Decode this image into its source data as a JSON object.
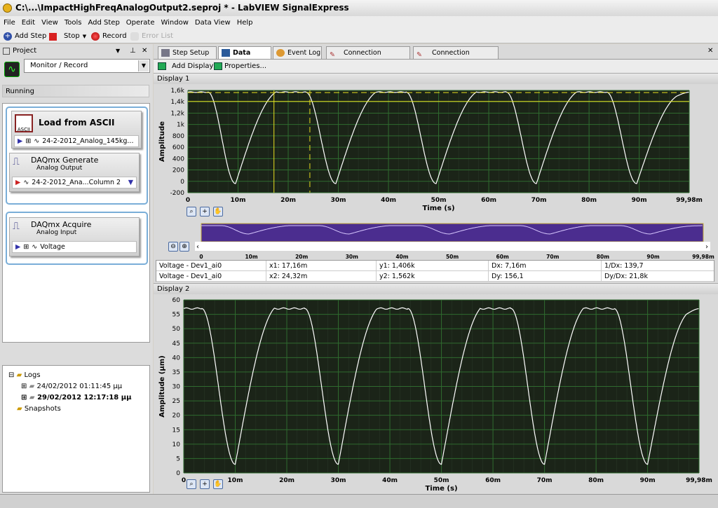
{
  "window": {
    "title": "C:\\...\\ImpactHighFreqAnalogOutput2.seproj * - LabVIEW SignalExpress"
  },
  "menu": [
    "File",
    "Edit",
    "View",
    "Tools",
    "Add Step",
    "Operate",
    "Window",
    "Data View",
    "Help"
  ],
  "toolbar": {
    "add_step": "Add Step",
    "stop": "Stop",
    "record": "Record",
    "error_list": "Error List"
  },
  "project": {
    "title": "Project",
    "mode": "Monitor / Record",
    "status": "Running",
    "steps": [
      {
        "title": "Load from ASCII",
        "subtitle": "",
        "line": "24-2-2012_Analog_145kg..."
      },
      {
        "title": "DAQmx Generate",
        "subtitle": "Analog Output",
        "line": "24-2-2012_Ana...Column 2"
      },
      {
        "title": "DAQmx Acquire",
        "subtitle": "Analog Input",
        "line": "Voltage"
      }
    ],
    "tree": {
      "logs": "Logs",
      "log_items": [
        "24/02/2012 01:11:45 μμ",
        "29/02/2012 12:17:18 μμ"
      ],
      "snapshots": "Snapshots"
    }
  },
  "tabs": [
    {
      "label": "Step Setup",
      "active": false
    },
    {
      "label": "Data View",
      "active": true
    },
    {
      "label": "Event Log",
      "active": false
    },
    {
      "label": "Connection Diagram",
      "active": false
    },
    {
      "label": "Connection Diagram",
      "active": false
    }
  ],
  "dataview_toolbar": {
    "add_display": "Add Display",
    "properties": "Properties..."
  },
  "colors": {
    "plot_bg": "#1b2418",
    "grid": "#2f6b2f",
    "trace": "#ffffff",
    "cursor": "#e8e020",
    "overview_bg": "#4b2d8f"
  },
  "cursor_table": [
    [
      "Voltage - Dev1_ai0",
      "x1: 17,16m",
      "y1: 1,406k",
      "Dx: 7,16m",
      "1/Dx: 139,7"
    ],
    [
      "Voltage - Dev1_ai0",
      "x2: 24,32m",
      "y2: 1,562k",
      "Dy: 156,1",
      "Dy/Dx: 21,8k"
    ]
  ],
  "chart_data": [
    {
      "type": "line",
      "title": "Display 1",
      "xlabel": "Time (s)",
      "ylabel": "Amplitude",
      "xlim": [
        0,
        99.98
      ],
      "ylim": [
        -200,
        1600
      ],
      "xticks": [
        "0",
        "10m",
        "20m",
        "30m",
        "40m",
        "50m",
        "60m",
        "70m",
        "80m",
        "90m",
        "99,98m"
      ],
      "yticks": [
        "-200",
        "0",
        "200",
        "400",
        "600",
        "800",
        "1k",
        "1,2k",
        "1,4k",
        "1,6k"
      ],
      "grid": true,
      "x_ms": [
        0,
        4,
        9.5,
        17.5,
        23.5,
        29.5,
        37.5,
        43.5,
        49.5,
        57.5,
        63.5,
        69.5,
        77.5,
        83.5,
        89.5,
        97.5,
        99.98
      ],
      "y": [
        1570,
        1570,
        -40,
        1570,
        1570,
        -40,
        1570,
        1570,
        -40,
        1570,
        1570,
        -40,
        1570,
        1570,
        -40,
        1500,
        1570
      ],
      "cursors": [
        {
          "x_ms": 17.16,
          "y": 1406,
          "style": "solid"
        },
        {
          "x_ms": 24.32,
          "y": 1562,
          "style": "dashed"
        }
      ]
    },
    {
      "type": "line",
      "title": "Display 2",
      "xlabel": "Time (s)",
      "ylabel": "Amplitude (μm)",
      "xlim": [
        0,
        99.98
      ],
      "ylim": [
        0,
        60
      ],
      "xticks": [
        "0",
        "10m",
        "20m",
        "30m",
        "40m",
        "50m",
        "60m",
        "70m",
        "80m",
        "90m",
        "99,98m"
      ],
      "yticks": [
        "0",
        "5",
        "10",
        "15",
        "20",
        "25",
        "30",
        "35",
        "40",
        "45",
        "50",
        "55",
        "60"
      ],
      "grid": true,
      "x_ms": [
        0,
        3.5,
        10,
        17.5,
        23.5,
        30,
        37.5,
        43.5,
        50,
        57.5,
        63.5,
        70,
        77.5,
        83.5,
        90,
        97.5,
        99.98
      ],
      "y": [
        57,
        57,
        3,
        57,
        57,
        3,
        57,
        57,
        3,
        57,
        57,
        3,
        57,
        57,
        3,
        55,
        57
      ]
    }
  ],
  "overview": {
    "xticks": [
      "0",
      "10m",
      "20m",
      "30m",
      "40m",
      "50m",
      "60m",
      "70m",
      "80m",
      "90m",
      "99,98m"
    ]
  }
}
